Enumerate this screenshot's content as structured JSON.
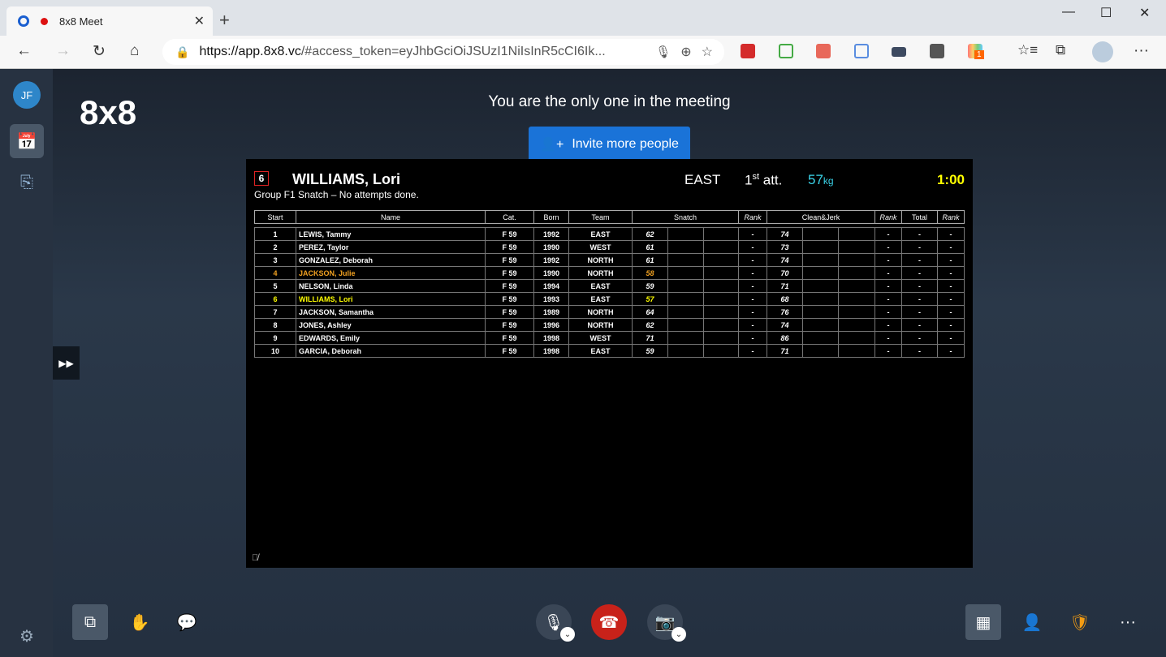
{
  "browser": {
    "tab_title": "8x8 Meet",
    "url_host": "https://app.8x8.vc",
    "url_rest": "/#access_token=eyJhbGciOiJSUzI1NiIsInR5cCI6Ik...",
    "extension_badge": "1"
  },
  "sidebar": {
    "avatar_initials": "JF"
  },
  "main": {
    "logo": "8x8",
    "status": "You are the only one in the meeting",
    "invite_label": "Invite more people"
  },
  "scoreboard": {
    "current": {
      "start": "6",
      "name": "WILLIAMS, Lori",
      "team": "EAST",
      "attempt_num": "1",
      "attempt_sup": "st",
      "attempt_label": " att.",
      "weight": "57",
      "weight_unit": "kg",
      "clock": "1:00"
    },
    "group_info": "Group F1 Snatch – No attempts done.",
    "headers": {
      "start": "Start",
      "name": "Name",
      "cat": "Cat.",
      "born": "Born",
      "team": "Team",
      "snatch": "Snatch",
      "rank1": "Rank",
      "cj": "Clean&Jerk",
      "rank2": "Rank",
      "total": "Total",
      "rank3": "Rank"
    },
    "highlight_colors": {
      "next": "#f0a020",
      "current": "#ffff00"
    },
    "rows": [
      {
        "start": "1",
        "name": "LEWIS, Tammy",
        "cat": "F 59",
        "born": "1992",
        "team": "EAST",
        "snatch": "62",
        "srank": "-",
        "cj": "74",
        "cjrank": "-",
        "total": "-",
        "rank": "-"
      },
      {
        "start": "2",
        "name": "PEREZ, Taylor",
        "cat": "F 59",
        "born": "1990",
        "team": "WEST",
        "snatch": "61",
        "srank": "-",
        "cj": "73",
        "cjrank": "-",
        "total": "-",
        "rank": "-"
      },
      {
        "start": "3",
        "name": "GONZALEZ, Deborah",
        "cat": "F 59",
        "born": "1992",
        "team": "NORTH",
        "snatch": "61",
        "srank": "-",
        "cj": "74",
        "cjrank": "-",
        "total": "-",
        "rank": "-"
      },
      {
        "start": "4",
        "name": "JACKSON, Julie",
        "cat": "F 59",
        "born": "1990",
        "team": "NORTH",
        "snatch": "58",
        "srank": "-",
        "cj": "70",
        "cjrank": "-",
        "total": "-",
        "rank": "-",
        "status": "next"
      },
      {
        "start": "5",
        "name": "NELSON, Linda",
        "cat": "F 59",
        "born": "1994",
        "team": "EAST",
        "snatch": "59",
        "srank": "-",
        "cj": "71",
        "cjrank": "-",
        "total": "-",
        "rank": "-"
      },
      {
        "start": "6",
        "name": "WILLIAMS, Lori",
        "cat": "F 59",
        "born": "1993",
        "team": "EAST",
        "snatch": "57",
        "srank": "-",
        "cj": "68",
        "cjrank": "-",
        "total": "-",
        "rank": "-",
        "status": "current"
      },
      {
        "start": "7",
        "name": "JACKSON, Samantha",
        "cat": "F 59",
        "born": "1989",
        "team": "NORTH",
        "snatch": "64",
        "srank": "-",
        "cj": "76",
        "cjrank": "-",
        "total": "-",
        "rank": "-"
      },
      {
        "start": "8",
        "name": "JONES, Ashley",
        "cat": "F 59",
        "born": "1996",
        "team": "NORTH",
        "snatch": "62",
        "srank": "-",
        "cj": "74",
        "cjrank": "-",
        "total": "-",
        "rank": "-"
      },
      {
        "start": "9",
        "name": "EDWARDS, Emily",
        "cat": "F 59",
        "born": "1998",
        "team": "WEST",
        "snatch": "71",
        "srank": "-",
        "cj": "86",
        "cjrank": "-",
        "total": "-",
        "rank": "-"
      },
      {
        "start": "10",
        "name": "GARCIA, Deborah",
        "cat": "F 59",
        "born": "1998",
        "team": "EAST",
        "snatch": "59",
        "srank": "-",
        "cj": "71",
        "cjrank": "-",
        "total": "-",
        "rank": "-"
      }
    ]
  }
}
